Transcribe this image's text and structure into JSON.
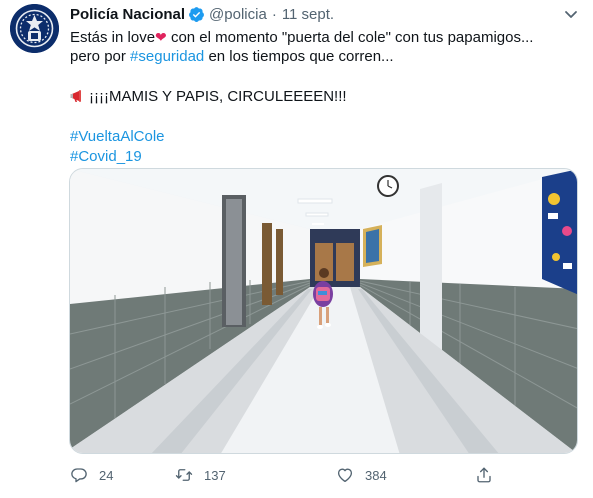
{
  "tweet": {
    "author": {
      "name": "Policía Nacional",
      "handle": "@policia",
      "verified": true,
      "avatar_icon": "police-badge-icon"
    },
    "separator": "·",
    "date": "11 sept.",
    "text": {
      "line1_a": "Estás in love",
      "line1_heart": "❤",
      "line1_b": " con el momento \"puerta del cole\" con tus papamigos...",
      "line2_a": "pero por ",
      "line2_hashtag": "#seguridad",
      "line2_b": " en los tiempos que corren...",
      "line4_icon": "megaphone-icon",
      "line4_text": "¡¡¡¡MAMIS Y PAPIS, CIRCULEEEEN!!!",
      "hashtags": [
        "#VueltaAlCole",
        "#Covid_19"
      ]
    },
    "media": {
      "type": "photo",
      "scene": "school-hallway"
    },
    "actions": {
      "reply_count": "24",
      "retweet_count": "137",
      "like_count": "384"
    }
  },
  "colors": {
    "hashtag": "#1b95e0",
    "text": "#0f1419",
    "muted": "#536471",
    "verified": "#1d9bf0",
    "heart": "#e0245e",
    "avatar_bg": "#0c2d6b"
  }
}
